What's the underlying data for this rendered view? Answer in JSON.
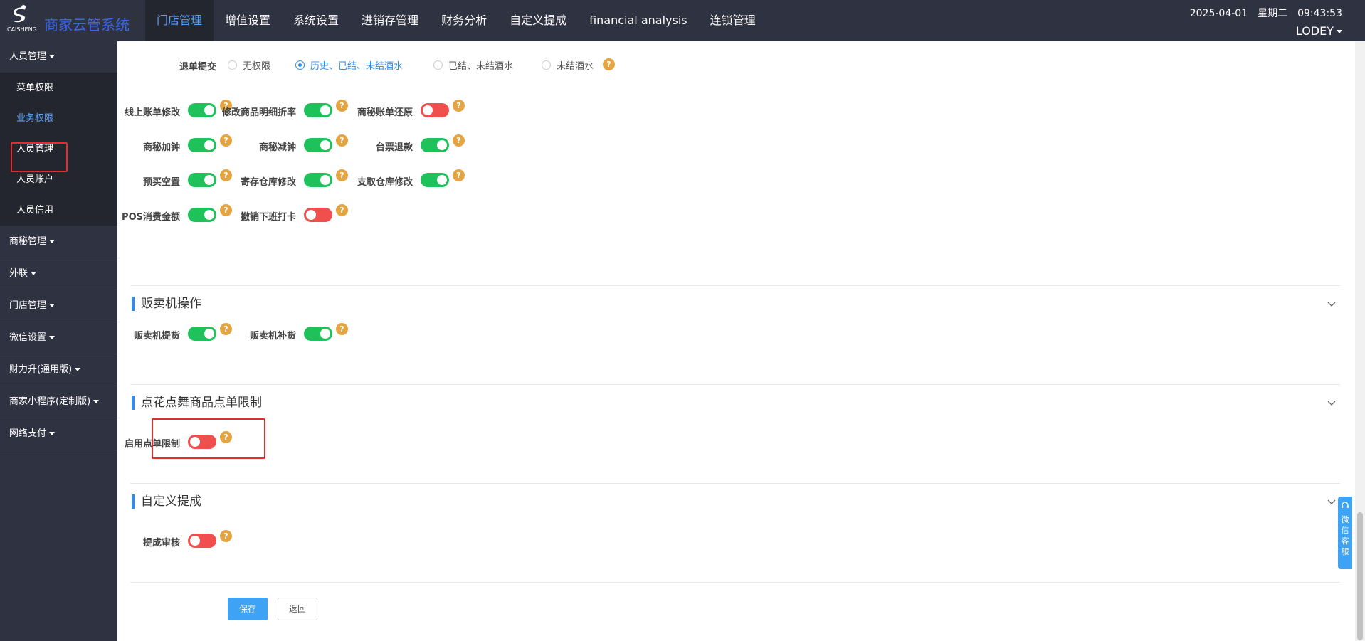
{
  "header": {
    "logo_text": "CAISHENG",
    "app_name": "商家云管系统",
    "nav": [
      "门店管理",
      "增值设置",
      "系统设置",
      "进销存管理",
      "财务分析",
      "自定义提成",
      "financial analysis",
      "连锁管理"
    ],
    "active_nav": "门店管理",
    "date": "2025-04-01",
    "weekday": "星期二",
    "time": "09:43:53",
    "user": "LODEY"
  },
  "sidebar": {
    "groups": [
      {
        "label": "人员管理",
        "items": [
          "菜单权限",
          "业务权限",
          "人员管理",
          "人员账户",
          "人员信用"
        ],
        "active_item": "业务权限"
      },
      {
        "label": "商秘管理"
      },
      {
        "label": "外联"
      },
      {
        "label": "门店管理"
      },
      {
        "label": "微信设置"
      },
      {
        "label": "财力升(通用版)"
      },
      {
        "label": "商家小程序(定制版)"
      },
      {
        "label": "网络支付"
      }
    ]
  },
  "refund": {
    "label": "退单提交",
    "options": [
      "无权限",
      "历史、已结、未结酒水",
      "已结、未结酒水",
      "未结酒水"
    ],
    "selected": "历史、已结、未结酒水"
  },
  "permissions": [
    {
      "label": "线上账单修改",
      "on": true
    },
    {
      "label": "修改商品明细折率",
      "on": true
    },
    {
      "label": "商秘账单还原",
      "on": false
    },
    {
      "label": "商秘加钟",
      "on": true
    },
    {
      "label": "商秘减钟",
      "on": true
    },
    {
      "label": "台票退款",
      "on": true
    },
    {
      "label": "预买空置",
      "on": true
    },
    {
      "label": "寄存仓库修改",
      "on": true
    },
    {
      "label": "支取仓库修改",
      "on": true
    },
    {
      "label": "POS消费金额",
      "on": true
    },
    {
      "label": "撤销下班打卡",
      "on": false
    }
  ],
  "sections": {
    "vending": {
      "title": "贩卖机操作",
      "items": [
        {
          "label": "贩卖机提货",
          "on": true
        },
        {
          "label": "贩卖机补货",
          "on": true
        }
      ]
    },
    "order_limit": {
      "title": "点花点舞商品点单限制",
      "items": [
        {
          "label": "启用点单限制",
          "on": false
        }
      ]
    },
    "commission": {
      "title": "自定义提成",
      "items": [
        {
          "label": "提成审核",
          "on": false
        }
      ]
    }
  },
  "buttons": {
    "save": "保存",
    "back": "返回"
  },
  "help_glyph": "?",
  "customer_service": "微信客服",
  "colors": {
    "switch_on": "#1fc25a",
    "switch_off": "#f0504d",
    "accent": "#2d8cf0",
    "nav_bg": "#2f3240",
    "help": "#e4a441",
    "highlight": "#e52b2b"
  }
}
